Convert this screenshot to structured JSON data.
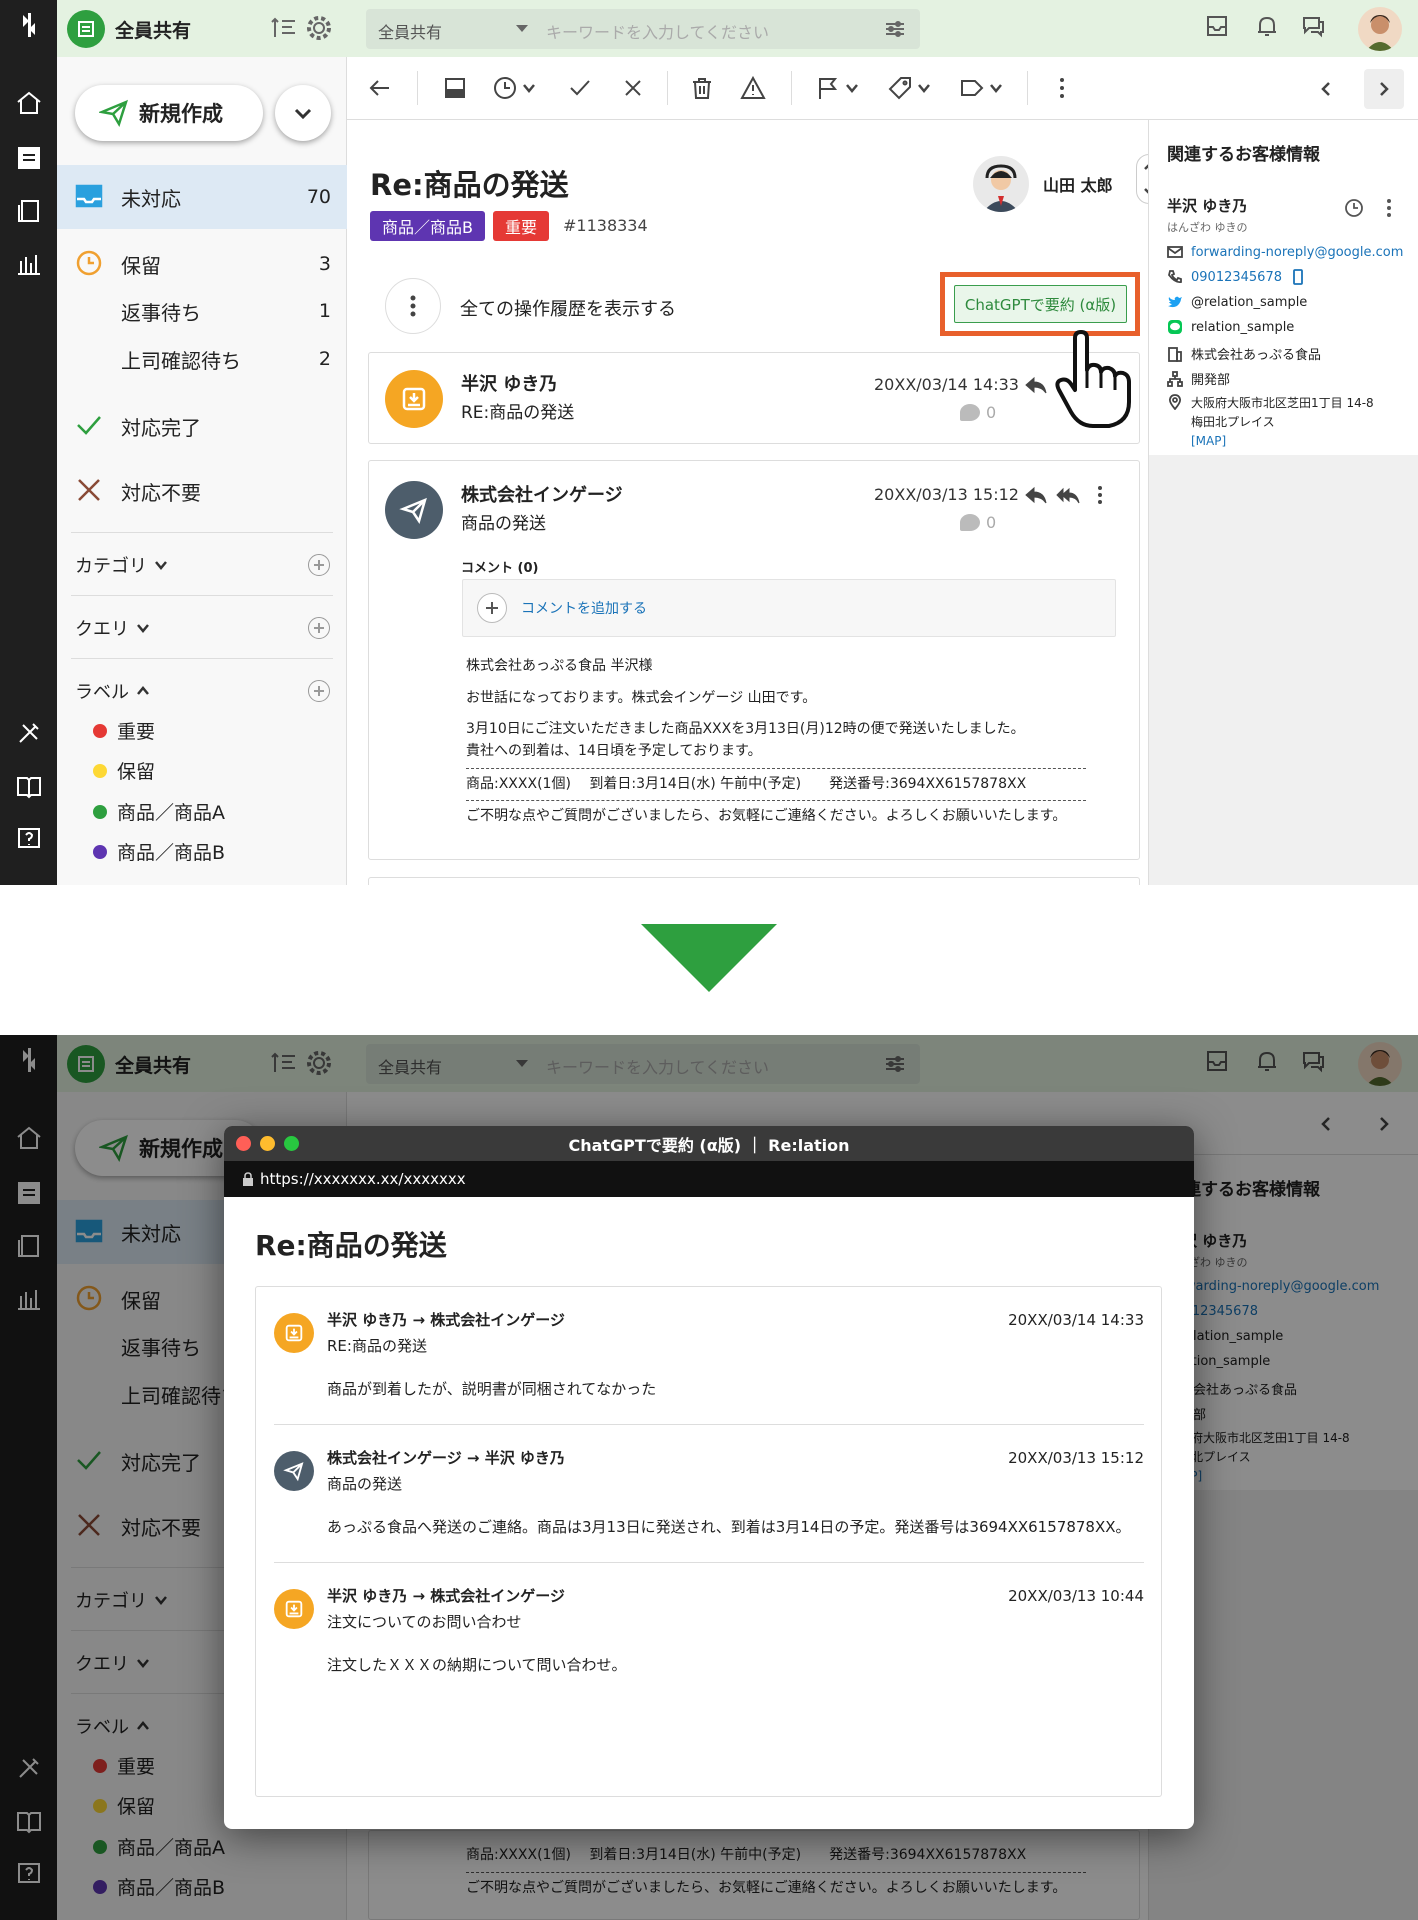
{
  "app": {
    "workspace": "全員共有",
    "scope_select": "全員共有",
    "search_placeholder": "キーワードを入力してください"
  },
  "sidebar": {
    "new_label": "新規作成",
    "items": [
      {
        "label": "未対応",
        "count": "70"
      },
      {
        "label": "保留",
        "count": "3"
      },
      {
        "label": "返事待ち",
        "count": "1"
      },
      {
        "label": "上司確認待ち",
        "count": "2"
      },
      {
        "label": "対応完了",
        "count": ""
      },
      {
        "label": "対応不要",
        "count": ""
      }
    ],
    "sections": {
      "category": "カテゴリ",
      "query": "クエリ",
      "label": "ラベル"
    },
    "labels": [
      {
        "name": "重要",
        "color": "#e53935"
      },
      {
        "name": "保留",
        "color": "#fdd835"
      },
      {
        "name": "商品／商品A",
        "color": "#2e9f3f"
      },
      {
        "name": "商品／商品B",
        "color": "#5e35b1"
      }
    ]
  },
  "ticket": {
    "title": "Re:商品の発送",
    "tags": [
      {
        "text": "商品／商品B",
        "color": "#5e35b1"
      },
      {
        "text": "重要",
        "color": "#e53935"
      }
    ],
    "number": "#1138334",
    "assignee": "山田 太郎",
    "history_label": "全ての操作履歴を表示する",
    "gpt_button": "ChatGPTで要約 (α版)"
  },
  "messages": [
    {
      "sender": "半沢 ゆき乃",
      "subject": "RE:商品の発送",
      "date": "20XX/03/14 14:33",
      "comments": "0"
    },
    {
      "sender": "株式会社インゲージ",
      "subject": "商品の発送",
      "date": "20XX/03/13 15:12",
      "comments": "0"
    }
  ],
  "comment_section": {
    "title": "コメント (0)",
    "add_label": "コメントを追加する"
  },
  "mail_body": {
    "line1": "株式会社あっぷる食品 半沢様",
    "line2": "お世話になっております。株式会インゲージ 山田です。",
    "line3": "3月10日にご注文いただきました商品XXXを3月13日(月)12時の便で発送いたしました。",
    "line4": "貴社への到着は、14日頃を予定しております。",
    "line5": "商品:XXXX(1個)　 到着日:3月14日(水) 午前中(予定)　　発送番号:3694XX6157878XX",
    "line6": "ご不明な点やご質問がございましたら、お気軽にご連絡ください。よろしくお願いいたします。"
  },
  "customer": {
    "heading": "関連するお客様情報",
    "name": "半沢 ゆき乃",
    "kana": "はんざわ ゆきの",
    "email": "forwarding-noreply@google.com",
    "phone": "09012345678",
    "twitter": "@relation_sample",
    "line": "relation_sample",
    "company": "株式会社あっぷる食品",
    "dept": "開発部",
    "address1": "大阪府大阪市北区芝田1丁目 14-8",
    "address2": "梅田北プレイス",
    "map": "[MAP]"
  },
  "modal": {
    "window_title": "ChatGPTで要約 (α版) ｜ Re:lation",
    "url": "https://xxxxxxx.xx/xxxxxxx",
    "heading": "Re:商品の発送",
    "summaries": [
      {
        "from": "半沢 ゆき乃 → 株式会社インゲージ",
        "subject": "RE:商品の発送",
        "date": "20XX/03/14 14:33",
        "text": "商品が到着したが、説明書が同梱されてなかった",
        "type": "in"
      },
      {
        "from": "株式会社インゲージ → 半沢 ゆき乃",
        "subject": "商品の発送",
        "date": "20XX/03/13 15:12",
        "text": "あっぷる食品へ発送のご連絡。商品は3月13日に発送され、到着は3月14日の予定。発送番号は3694XX6157878XX。",
        "type": "out"
      },
      {
        "from": "半沢 ゆき乃 → 株式会社インゲージ",
        "subject": "注文についてのお問い合わせ",
        "date": "20XX/03/13 10:44",
        "text": "注文したＸＸＸの納期について問い合わせ。",
        "type": "in"
      }
    ]
  },
  "colors": {
    "accent": "#2e9f3f",
    "highlight": "#e8602c",
    "incoming": "#f5a623",
    "outgoing": "#4d5d6b"
  }
}
